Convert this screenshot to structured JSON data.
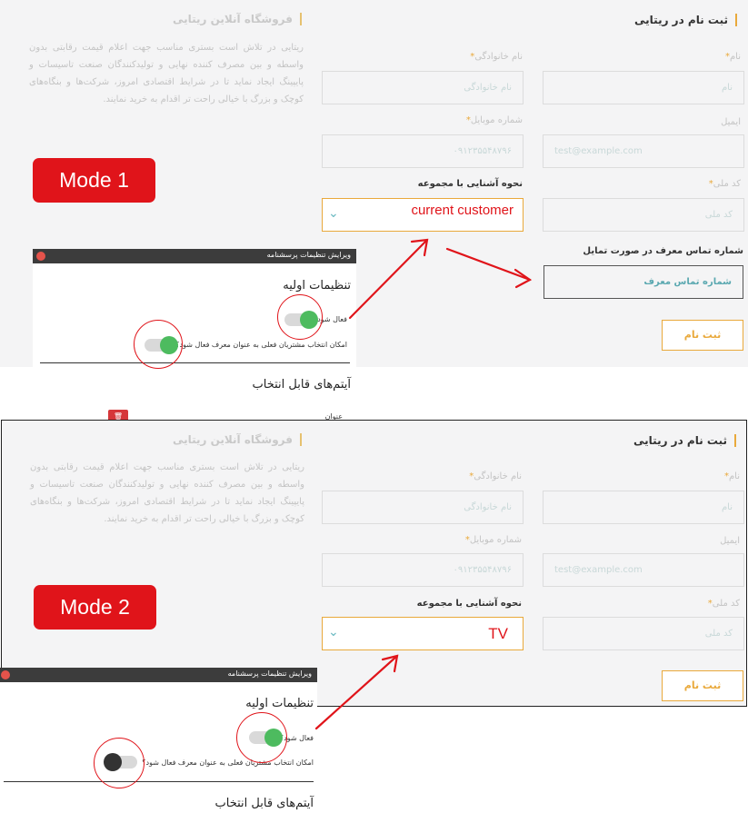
{
  "shop": {
    "title": "فروشگاه آنلاین ریتایی",
    "description": "ریتایی در تلاش است بستری مناسب جهت اعلام قیمت رقابتی بدون واسطه و بین مصرف کننده نهایی و تولیدکنندگان صنعت تاسیسات و پایپینگ ایجاد نماید تا در شرایط اقتصادی امروز، شرکت‌ها و بنگاه‌های کوچک و بزرگ با خیالی راحت تر اقدام به خرید نمایند."
  },
  "form": {
    "title": "ثبت نام در ریتایی",
    "first_name_label": "نام",
    "first_name_placeholder": "نام",
    "last_name_label": "نام خانوادگی",
    "last_name_placeholder": "نام خانوادگی",
    "email_label": "ایمیل",
    "email_placeholder": "test@example.com",
    "mobile_label": "شماره موبایل",
    "mobile_placeholder": "۰۹۱۲۳۵۵۴۸۷۹۶",
    "national_code_label": "کد ملی",
    "national_code_placeholder": "کد ملی",
    "acquaintance_label": "نحوه آشنایی با مجموعه",
    "referrer_label": "شماره تماس معرف در صورت تمایل",
    "referrer_placeholder": "شماره تماس معرف",
    "submit_label": "ثبت نام",
    "required_mark": "*"
  },
  "mode1": {
    "badge": "Mode 1",
    "selected_value": "current customer"
  },
  "mode2": {
    "badge": "Mode 2",
    "selected_value": "TV"
  },
  "dialog": {
    "title": "ویرایش تنظیمات پرسشنامه",
    "section_basic": "تنظیمات اولیه",
    "option_active": "فعال شود؟",
    "option_referrer": "امکان انتخاب مشتریان فعلی به عنوان معرف فعال شود؟",
    "section_items": "آیتم‌های قابل انتخاب",
    "field_title": "عنوان"
  },
  "toggles": {
    "mode1_active": true,
    "mode1_referrer": true,
    "mode2_active": true,
    "mode2_referrer": false
  },
  "colors": {
    "accent": "#e9a93b",
    "annotation": "#e0141a",
    "toggle_on": "#4dbb5f",
    "dialog_bar": "#3c3c3c"
  },
  "icons": [
    "chevron-down-icon",
    "close-icon",
    "trash-icon"
  ]
}
